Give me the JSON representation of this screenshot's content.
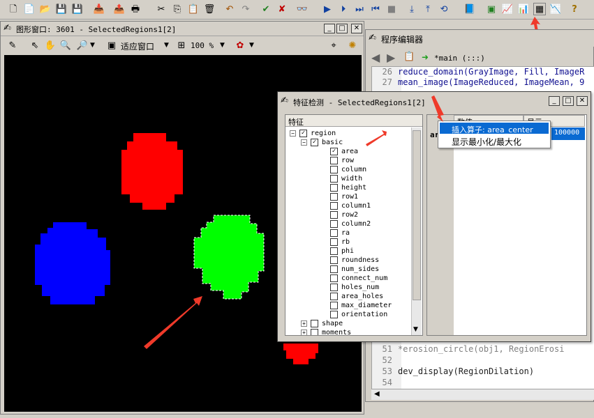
{
  "toolbar": {
    "icons": [
      "new-file-icon",
      "open-file-icon",
      "open-folder-icon",
      "save-icon",
      "save-all-icon",
      "import-icon",
      "export-icon",
      "print-icon",
      "cut-icon",
      "copy-icon",
      "paste-icon",
      "delete-icon",
      "undo-icon",
      "redo-icon",
      "check-icon",
      "cancel-icon",
      "glasses-icon",
      "run-icon",
      "step-icon",
      "step-over-icon",
      "step-back-icon",
      "stop-icon",
      "step-into-icon",
      "step-out-icon",
      "reset-icon",
      "help-book-icon",
      "graphics-icon",
      "chart-icon",
      "feature-inspect-icon",
      "histogram-icon",
      "help-icon"
    ],
    "help_glyph": "?"
  },
  "graphics_window": {
    "title": "图形窗口: 3601 - SelectedRegions1[2]",
    "fit_label": "适应窗口",
    "zoom_value": "100 %"
  },
  "program_editor": {
    "title": "程序编辑器",
    "procedure_label": "*main (:::)",
    "lines": [
      {
        "num": "26",
        "code": "reduce_domain(GrayImage, Fill, ImageR"
      },
      {
        "num": "27",
        "code": "mean_image(ImageReduced, ImageMean, 9"
      },
      {
        "num": "51",
        "code": "*erosion_circle(obj1, RegionErosi"
      },
      {
        "num": "52",
        "code": ""
      },
      {
        "num": "53",
        "code": "dev_display(RegionDilation)"
      },
      {
        "num": "54",
        "code": ""
      }
    ]
  },
  "feature_dialog": {
    "title": "特征检测 - SelectedRegions1[2]",
    "tree_header": "特征",
    "value_header": "数值",
    "display_header": "显示",
    "row_label": "ar",
    "value": "100000",
    "tree": {
      "region": "region",
      "basic": "basic",
      "features": [
        {
          "label": "area",
          "checked": true
        },
        {
          "label": "row",
          "checked": false
        },
        {
          "label": "column",
          "checked": false
        },
        {
          "label": "width",
          "checked": false
        },
        {
          "label": "height",
          "checked": false
        },
        {
          "label": "row1",
          "checked": false
        },
        {
          "label": "column1",
          "checked": false
        },
        {
          "label": "row2",
          "checked": false
        },
        {
          "label": "column2",
          "checked": false
        },
        {
          "label": "ra",
          "checked": false
        },
        {
          "label": "rb",
          "checked": false
        },
        {
          "label": "phi",
          "checked": false
        },
        {
          "label": "roundness",
          "checked": false
        },
        {
          "label": "num_sides",
          "checked": false
        },
        {
          "label": "connect_num",
          "checked": false
        },
        {
          "label": "holes_num",
          "checked": false
        },
        {
          "label": "area_holes",
          "checked": false
        },
        {
          "label": "max_diameter",
          "checked": false
        },
        {
          "label": "orientation",
          "checked": false
        }
      ],
      "shape": "shape",
      "moments": "moments"
    },
    "context_menu": {
      "insert_operator": "插入算子: area_center",
      "show_minmax": "显示最小化/最大化"
    }
  },
  "colors": {
    "annotation_arrow": "#ef3a2a",
    "highlight": "#0a6ad2",
    "region_red": "#ff0000",
    "region_green": "#00ff00",
    "region_blue": "#0000ff"
  }
}
